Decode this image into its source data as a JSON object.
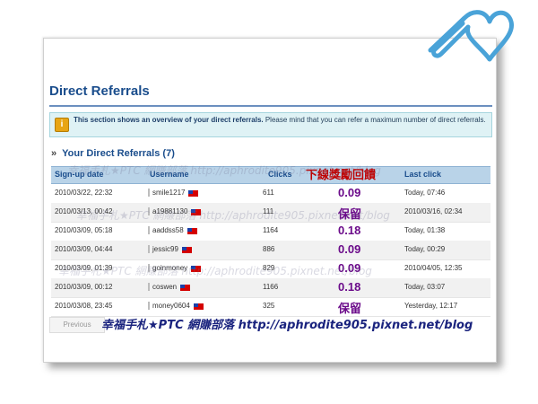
{
  "page": {
    "title": "Direct Referrals",
    "notice_bold": "This section shows an overview of your direct referrals.",
    "notice_rest": " Please mind that you can refer a maximum number of direct referrals.",
    "section_title": "Your Direct Referrals (7)",
    "columns": {
      "signup": "Sign-up date",
      "username": "Username",
      "clicks": "Clicks",
      "bonus": "下線獎勵回饋",
      "last_click": "Last click"
    }
  },
  "rows": [
    {
      "signup": "2010/03/22, 22:32",
      "username": "smile1217",
      "clicks": "611",
      "bonus": "0.09",
      "last_click": "Today, 07:46"
    },
    {
      "signup": "2010/03/13, 00:42",
      "username": "a19881130",
      "clicks": "111",
      "bonus": "保留",
      "last_click": "2010/03/16, 02:34"
    },
    {
      "signup": "2010/03/09, 05:18",
      "username": "aaddss58",
      "clicks": "1164",
      "bonus": "0.18",
      "last_click": "Today, 01:38"
    },
    {
      "signup": "2010/03/09, 04:44",
      "username": "jessic99",
      "clicks": "886",
      "bonus": "0.09",
      "last_click": "Today, 00:29"
    },
    {
      "signup": "2010/03/09, 01:39",
      "username": "goinmoney",
      "clicks": "829",
      "bonus": "0.09",
      "last_click": "2010/04/05, 12:35"
    },
    {
      "signup": "2010/03/09, 00:12",
      "username": "coswen",
      "clicks": "1166",
      "bonus": "0.18",
      "last_click": "Today, 03:07"
    },
    {
      "signup": "2010/03/08, 23:45",
      "username": "money0604",
      "clicks": "325",
      "bonus": "保留",
      "last_click": "Yesterday, 12:17"
    }
  ],
  "pager": {
    "previous": "Previous"
  },
  "banner": {
    "text_a": "幸福手札",
    "star": "★",
    "text_b": "PTC 網賺部落 http://aphrodite905.pixnet.net/blog"
  },
  "watermark": "幸福手札★PTC 網賺部落 http://aphrodite905.pixnet.net/blog",
  "colors": {
    "header_bg": "#b9d3e8",
    "title": "#1a4d8c",
    "bonus_header": "#c00000",
    "bonus_value": "#6b0b8a"
  }
}
